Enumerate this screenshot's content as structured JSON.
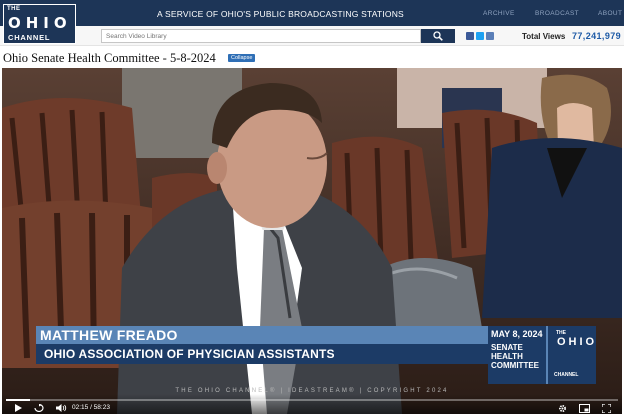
{
  "header": {
    "logo": {
      "the": "THE",
      "ohio": "OHIO",
      "channel": "CHANNEL"
    },
    "service_text": "A SERVICE OF OHIO'S PUBLIC BROADCASTING STATIONS",
    "nav": [
      "ARCHIVE",
      "BROADCAST",
      "ABOUT"
    ]
  },
  "search": {
    "placeholder": "Search Video Library",
    "total_views_label": "Total Views",
    "total_views_value": "77,241,979"
  },
  "social_icons": [
    "facebook-icon",
    "twitter-icon",
    "instagram-icon"
  ],
  "page": {
    "title": "Ohio Senate Health Committee - 5-8-2024",
    "collapse_label": "Collapse"
  },
  "video": {
    "lower_third": {
      "name": "MATTHEW FREADO",
      "organization": "OHIO ASSOCIATION OF PHYSICIAN ASSISTANTS",
      "date": "MAY 8, 2024",
      "committee": "SENATE HEALTH COMMITTEE",
      "logo_the": "THE",
      "logo_ohio": "OHIO",
      "logo_channel": "CHANNEL"
    },
    "ticker": "THE OHIO CHANNEL® | IDEASTREAM® | COPYRIGHT 2024",
    "current_time": "02:15",
    "duration": "58:23",
    "time_display": "02:15 / 58:23",
    "progress": 0.039
  },
  "colors": {
    "brand_navy": "#1d3557",
    "lower_third_light": "#5a85b6",
    "lower_third_dark": "#1c3b66",
    "views_blue": "#1d5aa6"
  }
}
